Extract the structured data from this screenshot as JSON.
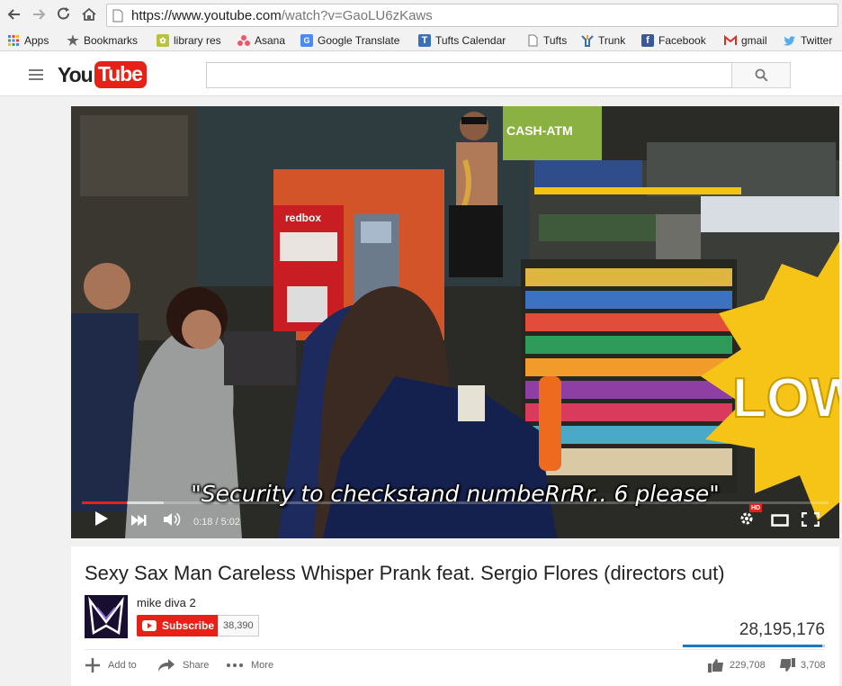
{
  "browser": {
    "url_host": "https://www.youtube.com",
    "url_path": "/watch?v=GaoLU6zKaws",
    "bookmarks": [
      {
        "label": "Apps",
        "icon": "apps-grid-icon"
      },
      {
        "label": "Bookmarks",
        "icon": "star-icon"
      },
      {
        "label": "library res",
        "icon": "library-icon"
      },
      {
        "label": "Asana",
        "icon": "asana-icon"
      },
      {
        "label": "Google Translate",
        "icon": "translate-icon"
      },
      {
        "label": "Tufts Calendar",
        "icon": "calendar-icon"
      },
      {
        "label": "Tufts",
        "icon": "page-icon"
      },
      {
        "label": "Trunk",
        "icon": "trunk-icon"
      },
      {
        "label": "Facebook",
        "icon": "facebook-icon"
      },
      {
        "label": "gmail",
        "icon": "gmail-icon"
      },
      {
        "label": "Twitter",
        "icon": "twitter-icon"
      }
    ]
  },
  "header": {
    "logo_you": "You",
    "logo_tube": "Tube",
    "search_placeholder": ""
  },
  "player": {
    "subtitle": "\"Security to checkstand numbeRrRr.. 6 please\"",
    "time": "0:18 / 5:02",
    "progress": 0.06,
    "buffered": 0.11,
    "quality_badge": "HD"
  },
  "video": {
    "title": "Sexy Sax Man Careless Whisper Prank feat. Sergio Flores (directors cut)",
    "channel": "mike diva 2",
    "subscribe_label": "Subscribe",
    "subscriber_count": "38,390",
    "views": "28,195,176",
    "like_ratio": 0.984,
    "likes": "229,708",
    "dislikes": "3,708",
    "actions": {
      "add_to": "Add to",
      "share": "Share",
      "more": "More"
    }
  },
  "colors": {
    "brand_red": "#e62117",
    "like_blue": "#167ac6"
  }
}
